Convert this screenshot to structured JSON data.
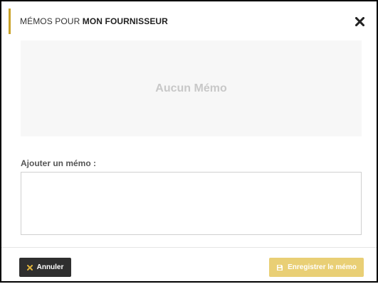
{
  "modal": {
    "title_prefix": "MÉMOS POUR",
    "title_supplier": "MON FOURNISSEUR",
    "close_icon": "close-icon"
  },
  "memos": {
    "empty_text": "Aucun Mémo"
  },
  "form": {
    "add_label": "Ajouter un mémo :",
    "textarea_value": "",
    "textarea_placeholder": ""
  },
  "footer": {
    "cancel_label": "Annuler",
    "save_label": "Enregistrer le mémo"
  },
  "colors": {
    "accent": "#c9a227",
    "cancel_bg": "#2f2f2f",
    "save_bg": "#e9cf75",
    "cancel_icon": "#e0b43c"
  }
}
